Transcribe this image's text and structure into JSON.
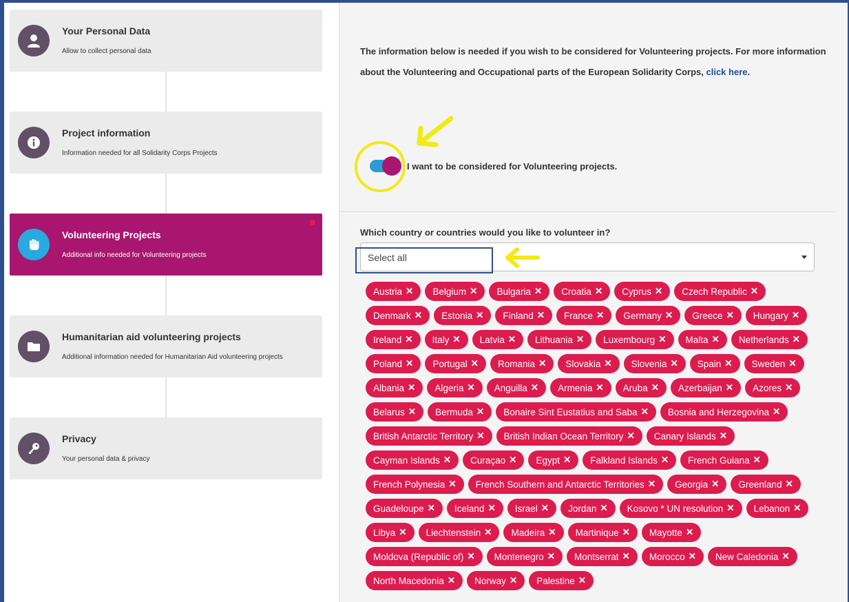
{
  "steps": [
    {
      "title": "Your Personal Data",
      "desc": "Allow to collect personal data",
      "icon": "user-icon"
    },
    {
      "title": "Project information",
      "desc": "Information needed for all Solidarity Corps Projects",
      "icon": "info-icon"
    },
    {
      "title": "Volunteering Projects",
      "desc": "Additional info needed for Volunteering projects",
      "icon": "hand-icon",
      "active": true
    },
    {
      "title": "Humanitarian aid volunteering projects",
      "desc": "Additional information needed for Humanitarian Aid volunteering projects",
      "icon": "folder-icon"
    },
    {
      "title": "Privacy",
      "desc": "Your personal data & privacy",
      "icon": "key-icon"
    }
  ],
  "main": {
    "info_text": "The information below is needed if you wish to be considered for Volunteering projects. For more information about the Volunteering and Occupational parts of the European Solidarity Corps,",
    "info_link": "click here",
    "info_end": ".",
    "toggle_label": "I want to be considered for Volunteering projects.",
    "toggle_on": true,
    "question": "Which country or countries would you like to volunteer in?",
    "select_value": "Select all",
    "tag_remove_symbol": "✕",
    "countries": [
      "Austria",
      "Belgium",
      "Bulgaria",
      "Croatia",
      "Cyprus",
      "Czech Republic",
      "Denmark",
      "Estonia",
      "Finland",
      "France",
      "Germany",
      "Greece",
      "Hungary",
      "Ireland",
      "Italy",
      "Latvia",
      "Lithuania",
      "Luxembourg",
      "Malta",
      "Netherlands",
      "Poland",
      "Portugal",
      "Romania",
      "Slovakia",
      "Slovenia",
      "Spain",
      "Sweden",
      "Albania",
      "Algeria",
      "Anguilla",
      "Armenia",
      "Aruba",
      "Azerbaijan",
      "Azores",
      "Belarus",
      "Bermuda",
      "Bonaire Sint Eustatius and Saba",
      "Bosnia and Herzegovina",
      "British Antarctic Territory",
      "British Indian Ocean Territory",
      "Canary Islands",
      "Cayman Islands",
      "Curaçao",
      "Egypt",
      "Falkland Islands",
      "French Guiana",
      "French Polynesia",
      "French Southern and Antarctic Territories",
      "Georgia",
      "Greenland",
      "Guadeloupe",
      "Iceland",
      "Israel",
      "Jordan",
      "Kosovo * UN resolution",
      "Lebanon",
      "Libya",
      "Liechtenstein",
      "Madeira",
      "Martinique",
      "Mayotte",
      "Moldova (Republic of)",
      "Montenegro",
      "Montserrat",
      "Morocco",
      "New Caledonia",
      "North Macedonia",
      "Norway",
      "Palestine"
    ]
  },
  "colors": {
    "active_step": "#a8166f",
    "tag": "#dc1c4f",
    "toggle_track": "#2b9bd6",
    "annotation": "#f2ea16"
  }
}
